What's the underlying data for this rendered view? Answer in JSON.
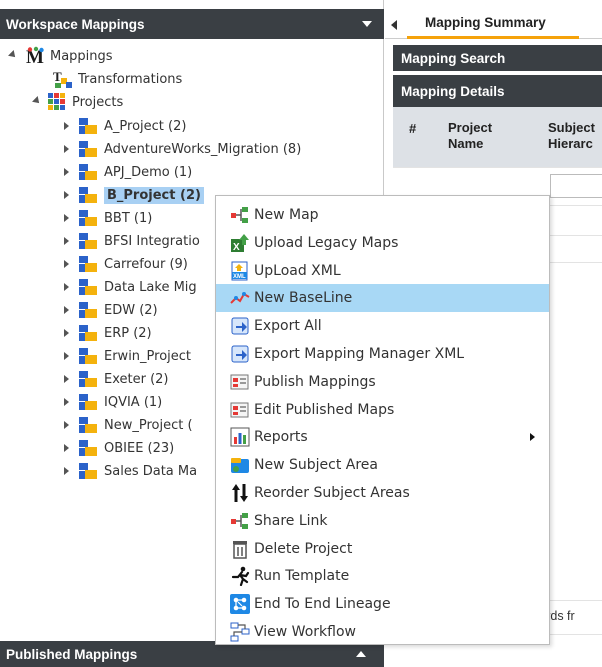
{
  "workspace_panel": {
    "title": "Workspace Mappings",
    "tree": {
      "root_label": "Mappings",
      "transformations_label": "Transformations",
      "projects_label": "Projects",
      "projects": [
        "A_Project (2)",
        "AdventureWorks_Migration (8)",
        "APJ_Demo (1)",
        "B_Project (2)",
        "BBT (1)",
        "BFSI Integratio",
        "Carrefour (9)",
        "Data Lake Mig",
        "EDW (2)",
        "ERP (2)",
        "Erwin_Project",
        "Exeter (2)",
        "IQVIA (1)",
        "New_Project (",
        "OBIEE (23)",
        "Sales Data Ma"
      ],
      "selected_index": 3
    }
  },
  "published_panel": {
    "title": "Published Mappings"
  },
  "right_panel": {
    "tab_label": "Mapping Summary",
    "mapping_search": "Mapping Search",
    "mapping_details": "Mapping Details",
    "columns": {
      "num": "#",
      "project_name_1": "Project",
      "project_name_2": "Name",
      "subject_1": "Subject",
      "subject_2": "Hierarc"
    },
    "records_text": "cords fr"
  },
  "context_menu": {
    "items": [
      {
        "label": "New Map",
        "icon": "new-map-icon"
      },
      {
        "label": "Upload Legacy Maps",
        "icon": "upload-legacy-icon"
      },
      {
        "label": "UpLoad XML",
        "icon": "upload-xml-icon"
      },
      {
        "label": "New BaseLine",
        "icon": "baseline-icon",
        "highlight": true
      },
      {
        "label": "Export All",
        "icon": "export-all-icon"
      },
      {
        "label": "Export Mapping Manager XML",
        "icon": "export-xml-icon"
      },
      {
        "label": "Publish Mappings",
        "icon": "publish-mappings-icon"
      },
      {
        "label": "Edit Published Maps",
        "icon": "edit-published-icon"
      },
      {
        "label": "Reports",
        "icon": "reports-icon",
        "submenu": true
      },
      {
        "label": "New Subject Area",
        "icon": "subject-area-icon"
      },
      {
        "label": "Reorder Subject Areas",
        "icon": "reorder-icon"
      },
      {
        "label": "Share Link",
        "icon": "share-link-icon"
      },
      {
        "label": "Delete Project",
        "icon": "delete-icon"
      },
      {
        "label": "Run Template",
        "icon": "run-template-icon"
      },
      {
        "label": "End To End Lineage",
        "icon": "lineage-icon"
      },
      {
        "label": "View Workflow",
        "icon": "workflow-icon"
      }
    ]
  },
  "colors": {
    "header_bg": "#3a3f44",
    "selection": "#a8d0f3",
    "menu_highlight": "#a8d8f5",
    "tab_accent": "#f5a20a",
    "project_blue": "#2b62c9",
    "project_yellow": "#f4b20d"
  }
}
